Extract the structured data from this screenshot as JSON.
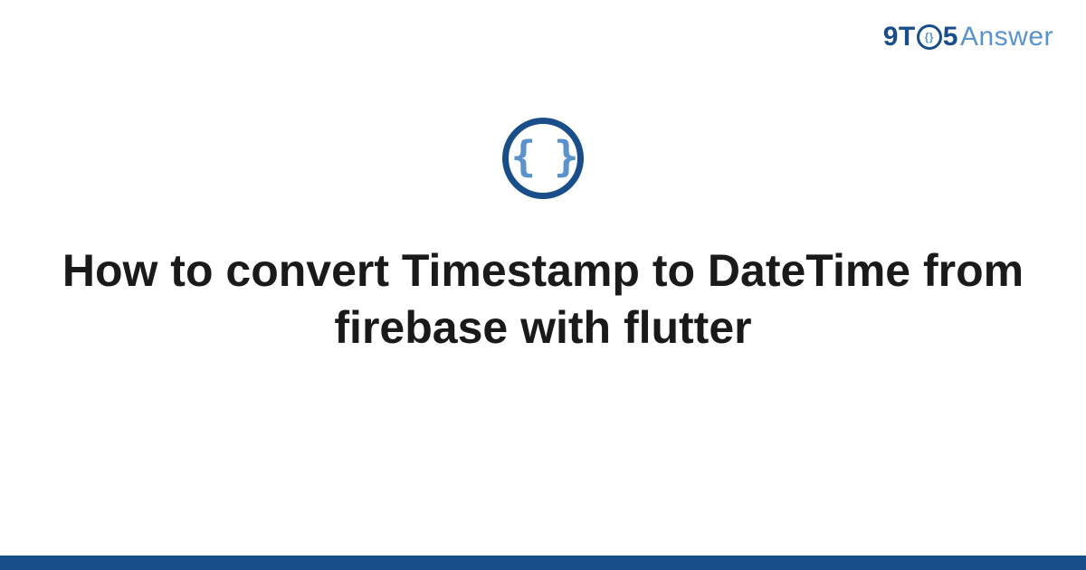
{
  "logo": {
    "part1": "9T",
    "circle_content": "{}",
    "part2": "5",
    "part3": "Answer"
  },
  "main_icon": {
    "braces": "{ }"
  },
  "title": "How to convert Timestamp to DateTime from firebase with flutter",
  "colors": {
    "primary": "#1a4e8a",
    "secondary": "#5a93cc"
  }
}
